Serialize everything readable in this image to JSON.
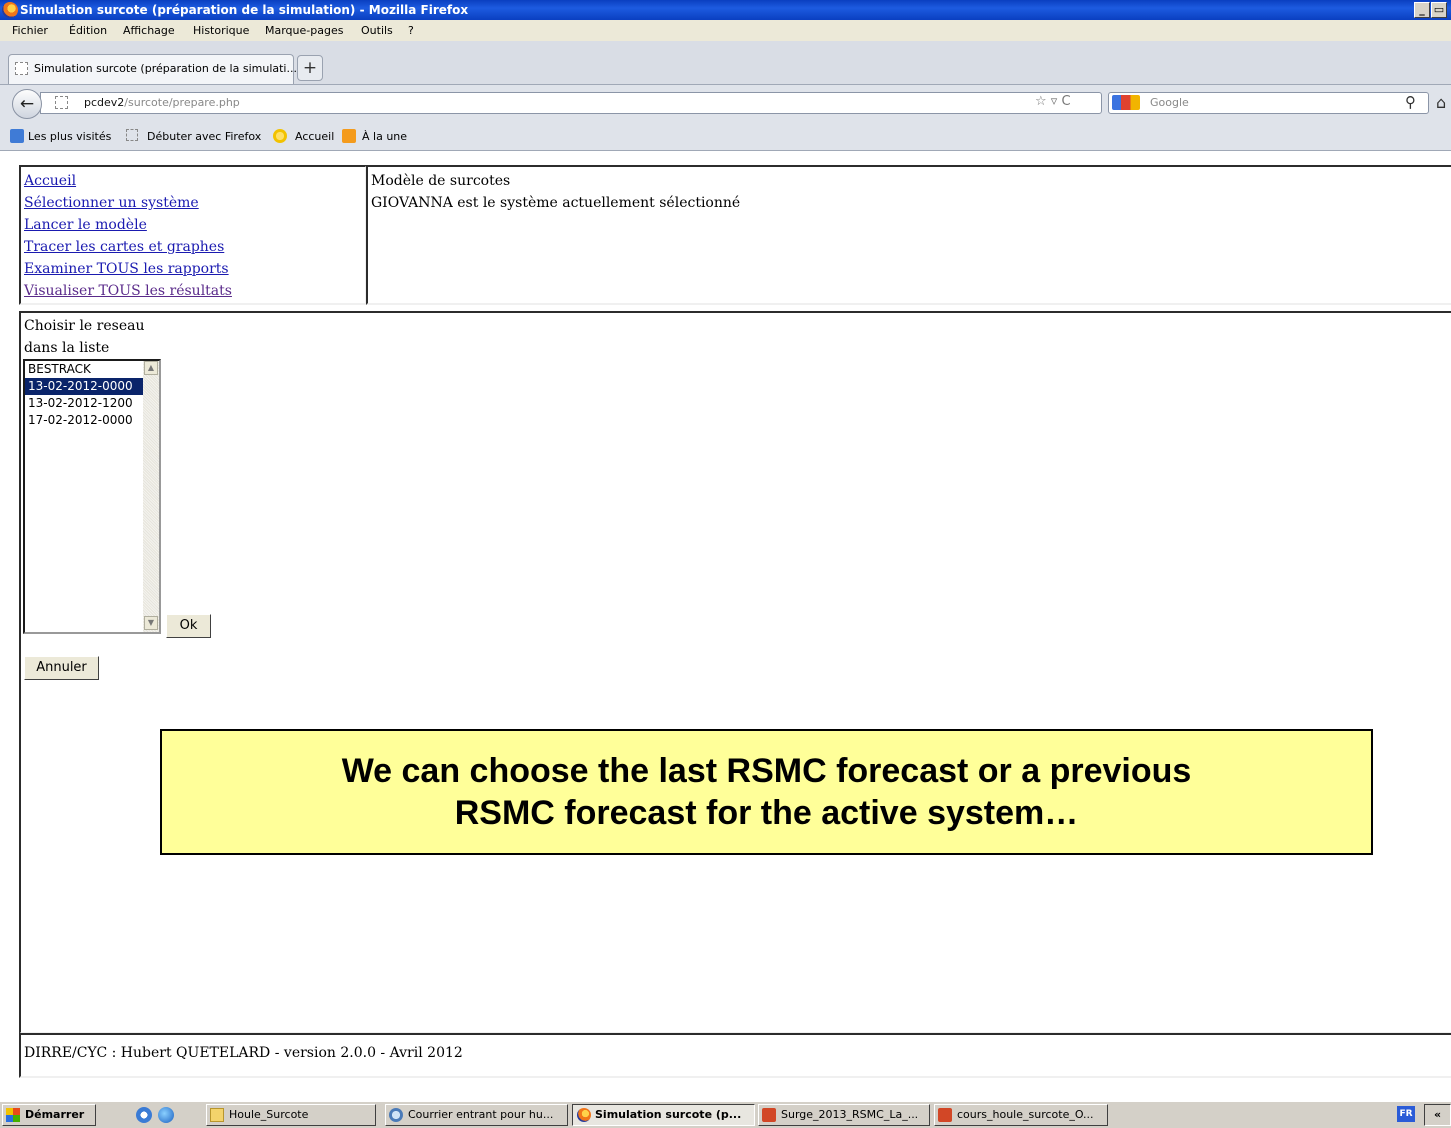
{
  "window": {
    "title": "Simulation surcote (préparation de la simulation) - Mozilla Firefox",
    "min_btn": "_",
    "max_btn": "▭"
  },
  "menubar": {
    "items": [
      "Fichier",
      "Édition",
      "Affichage",
      "Historique",
      "Marque-pages",
      "Outils",
      "?"
    ]
  },
  "tabs": {
    "active_tab_label": "Simulation surcote (préparation de la simulati...",
    "new_tab_label": "+"
  },
  "navbar": {
    "url_host": "pcdev2",
    "url_path": "/surcote/prepare.php",
    "url_icons": "☆ ▿ C",
    "search_placeholder": "Google",
    "search_icon": "magnifier-icon",
    "home_icon": "home-icon"
  },
  "bookmarks": {
    "items": [
      "Les plus visités",
      "Débuter avec Firefox",
      "Accueil",
      "À la une"
    ]
  },
  "nav_frame": {
    "links": [
      "Accueil",
      "Sélectionner un système",
      "Lancer le modèle",
      "Tracer les cartes et graphes",
      "Examiner TOUS les rapports",
      "Visualiser TOUS les résultats"
    ]
  },
  "header_frame": {
    "title": "Modèle de surcotes",
    "status": "GIOVANNA est le système actuellement sélectionné"
  },
  "main_frame": {
    "prompt_line1": "Choisir le reseau",
    "prompt_line2": "dans la liste",
    "options": [
      "BESTRACK",
      "13-02-2012-0000",
      "13-02-2012-1200",
      "17-02-2012-0000"
    ],
    "selected_option": "13-02-2012-0000",
    "ok_label": "Ok",
    "cancel_label": "Annuler"
  },
  "callout": {
    "line1": "We can choose the last RSMC forecast or a previous",
    "line2": "RSMC forecast for the active system…"
  },
  "footer_frame": {
    "text": "DIRRE/CYC : Hubert QUETELARD - version 2.0.0 - Avril 2012"
  },
  "taskbar": {
    "start_label": "Démarrer",
    "tasks": [
      "Houle_Surcote",
      "Courrier entrant pour hu...",
      "Simulation surcote (p...",
      "Surge_2013_RSMC_La_...",
      "cours_houle_surcote_O..."
    ],
    "tray_lang": "FR",
    "tray_more": "«"
  },
  "colors": {
    "selection": "#0a246a",
    "link": "#1a1ab0",
    "visited_link": "#5a2a8a",
    "callout_bg": "#ffff99"
  }
}
